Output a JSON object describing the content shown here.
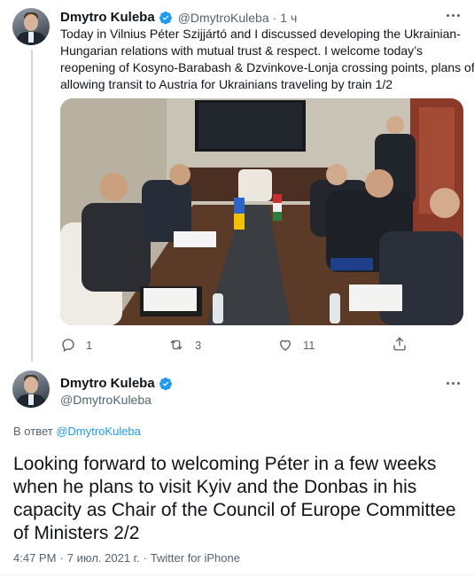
{
  "tweet1": {
    "name": "Dmytro Kuleba",
    "handle": "@DmytroKuleba",
    "dot": "·",
    "time": "1 ч",
    "text_lines": [
      "Today in Vilnius Péter Szijjártó and I discussed developing the Ukrainian-",
      "Hungarian relations with mutual trust & respect. I welcome today’s",
      "reopening of Kosyno-Barabash & Dzvinkove-Lonja crossing points, plans of",
      "allowing transit to Austria for Ukrainians traveling by train 1/2"
    ],
    "actions": {
      "reply_count": "1",
      "retweet_count": "3",
      "like_count": "11"
    }
  },
  "tweet2": {
    "name": "Dmytro Kuleba",
    "handle": "@DmytroKuleba",
    "reply_prefix": "В ответ",
    "reply_handle": "@DmytroKuleba",
    "text_lines": [
      "Looking forward to welcoming Péter in a few weeks",
      "when he plans to visit Kyiv and the Donbas in his",
      "capacity as Chair of the Council of Europe Committee",
      "of Ministers 2/2"
    ],
    "time": "4:47 PM",
    "sep1": "·",
    "date": "7 июл. 2021 г.",
    "sep2": "·",
    "source": "Twitter for iPhone"
  },
  "colors": {
    "accent": "#1d9bf0",
    "muted": "#536471",
    "text": "#0f1419",
    "border": "#eff3f4"
  }
}
